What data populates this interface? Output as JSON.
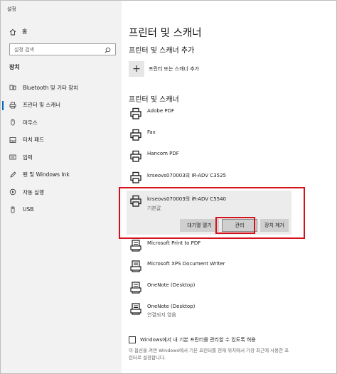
{
  "app": {
    "title": "설정"
  },
  "sidebar": {
    "home_label": "홈",
    "search_placeholder": "설정 검색",
    "section_label": "장치",
    "items": [
      {
        "label": "Bluetooth 및 기타 장치",
        "icon": "bluetooth-icon"
      },
      {
        "label": "프린터 및 스캐너",
        "icon": "printer-icon",
        "active": true
      },
      {
        "label": "마우스",
        "icon": "mouse-icon"
      },
      {
        "label": "터치 패드",
        "icon": "touchpad-icon"
      },
      {
        "label": "입력",
        "icon": "keyboard-icon"
      },
      {
        "label": "펜 및 Windows Ink",
        "icon": "pen-icon"
      },
      {
        "label": "자동 실행",
        "icon": "autoplay-icon"
      },
      {
        "label": "USB",
        "icon": "usb-icon"
      }
    ]
  },
  "main": {
    "title": "프린터 및 스캐너",
    "add_heading": "프린터 및 스캐너 추가",
    "add_label": "프린터 또는 스캐너 추가",
    "list_heading": "프린터 및 스캐너",
    "printers": [
      {
        "name": "Adobe PDF",
        "status": ""
      },
      {
        "name": "Fax",
        "status": ""
      },
      {
        "name": "Hancom PDF",
        "status": ""
      },
      {
        "name": "krseovs070003의 iR-ADV C3525",
        "status": ""
      },
      {
        "name": "krseovs070003의 iR-ADV C5540",
        "status": "기본값",
        "selected": true
      },
      {
        "name": "Microsoft Print to PDF",
        "status": ""
      },
      {
        "name": "Microsoft XPS Document Writer",
        "status": ""
      },
      {
        "name": "OneNote (Desktop)",
        "status": ""
      },
      {
        "name": "OneNote (Desktop)",
        "status": "연결되지 않음"
      }
    ],
    "buttons": {
      "open_queue": "대기열 열기",
      "manage": "관리",
      "remove": "장치 제거"
    },
    "checkbox_label": "Windows에서 내 기본 프린터를 관리할 수 있도록 허용",
    "hint": "이 옵션을 켜면 Windows에서 기본 프린터를 현재 위치에서 가장 최근에 사용한 프린터로 설정합니다."
  },
  "colors": {
    "accent": "#0067c0",
    "highlight": "#d3121b"
  }
}
